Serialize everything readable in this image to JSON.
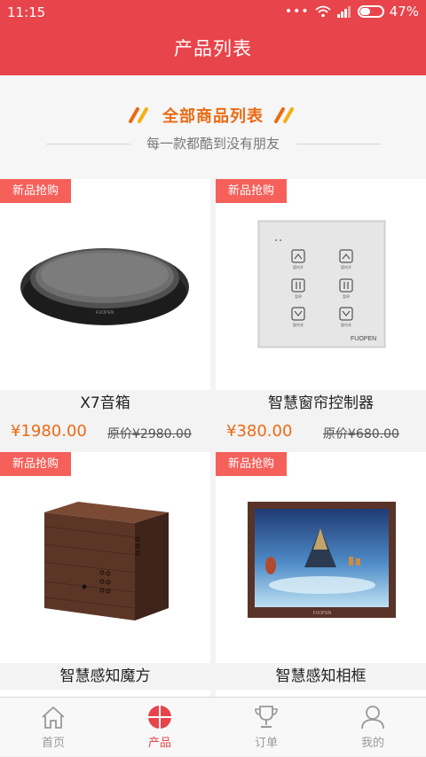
{
  "status_bar": {
    "time": "11:15",
    "battery": "47%",
    "battery_level": 0.47
  },
  "header": {
    "title": "产品列表"
  },
  "intro": {
    "title": "全部商品列表",
    "subtitle": "每一款都酷到没有朋友"
  },
  "products": [
    {
      "badge": "新品抢购",
      "name": "X7音箱",
      "price": "¥1980.00",
      "original_price": "原价¥2980.00"
    },
    {
      "badge": "新品抢购",
      "name": "智慧窗帘控制器",
      "price": "¥380.00",
      "original_price": "原价¥680.00",
      "brand": "FUOPEN"
    },
    {
      "badge": "新品抢购",
      "name": "智慧感知魔方"
    },
    {
      "badge": "新品抢购",
      "name": "智慧感知相框",
      "brand": "FUOPEN"
    }
  ],
  "tabbar": {
    "tabs": [
      {
        "label": "首页",
        "icon": "home-icon",
        "active": false
      },
      {
        "label": "产品",
        "icon": "product-icon",
        "active": true
      },
      {
        "label": "订单",
        "icon": "trophy-icon",
        "active": false
      },
      {
        "label": "我的",
        "icon": "user-icon",
        "active": false
      }
    ]
  },
  "colors": {
    "primary": "#e8444b",
    "accent": "#ec6a12",
    "badge": "#f5605a"
  }
}
